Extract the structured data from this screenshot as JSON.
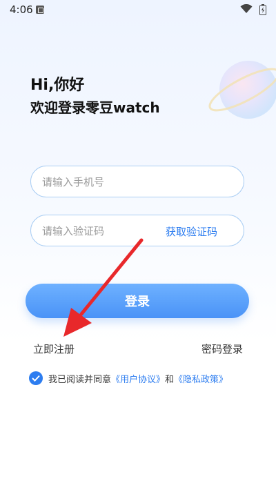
{
  "status_bar": {
    "time": "4:06",
    "notification_icon": "notification-a-icon",
    "wifi_icon": "wifi-icon",
    "battery_icon": "battery-charging-icon"
  },
  "header": {
    "greeting": "Hi,你好",
    "welcome": "欢迎登录零豆watch"
  },
  "form": {
    "phone_placeholder": "请输入手机号",
    "code_placeholder": "请输入验证码",
    "get_code_label": "获取验证码",
    "login_label": "登录"
  },
  "links": {
    "register": "立即注册",
    "password_login": "密码登录"
  },
  "agreement": {
    "checked": true,
    "prefix": "我已阅读并同意",
    "user_agreement": "《用户协议》",
    "and": "和",
    "privacy_policy": "《隐私政策》"
  },
  "colors": {
    "accent": "#2d7df0",
    "button": "#5a9ff8",
    "annotation_arrow": "#e8282b"
  }
}
